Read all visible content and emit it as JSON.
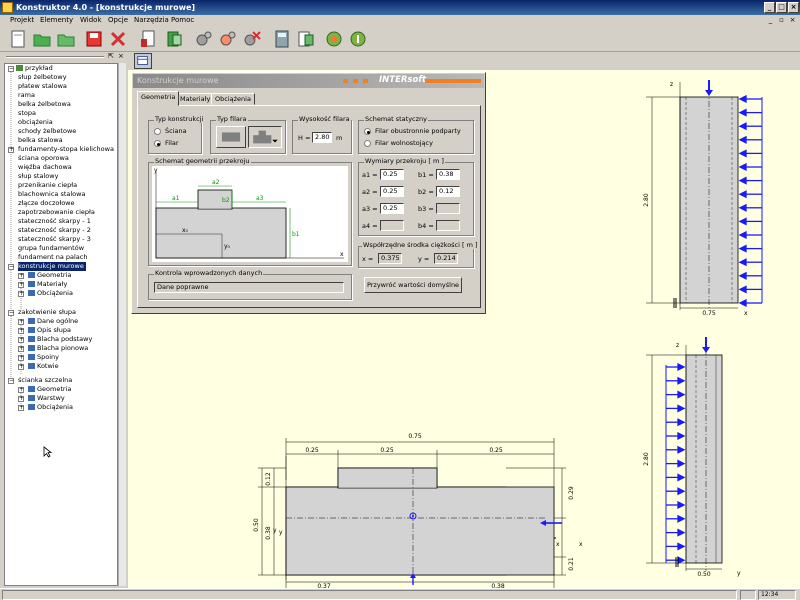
{
  "window": {
    "title": "Konstruktor 4.0 - [konstrukcje murowe]",
    "min": "_",
    "max": "□",
    "close": "×"
  },
  "menu": [
    "Projekt",
    "Elementy",
    "Widok",
    "Opcje",
    "Narzędzia",
    "Pomoc"
  ],
  "tree": {
    "root": "przykład",
    "items": [
      "słup żelbetowy",
      "płatew stalowa",
      "rama",
      "belka żelbetowa",
      "stopa",
      "obciążenia",
      "schody żelbetowe",
      "belka stalowa",
      "fundamenty-stopa kielichowa",
      "ściana oporowa",
      "więźba dachowa",
      "słup stalowy",
      "przenikanie ciepła",
      "blachownica stalowa",
      "złącze doczołowe",
      "zapotrzebowanie ciepła",
      "stateczność skarpy - 1",
      "stateczność skarpy - 2",
      "stateczność skarpy - 3",
      "grupa fundamentów",
      "fundament na palach"
    ],
    "selected": "konstrukcje murowe",
    "selected_children": [
      "Geometria",
      "Materiały",
      "Obciążenia"
    ],
    "group2": "zakotwienie słupa",
    "group2_children": [
      "Dane ogólne",
      "Opis słupa",
      "Blacha podstawy",
      "Blacha pionowa",
      "Spoiny",
      "Kotwie"
    ],
    "group3": "ścianka szczelna",
    "group3_children": [
      "Geometria",
      "Warstwy",
      "Obciążenia"
    ]
  },
  "dialog": {
    "title": "Konstrukcje murowe",
    "brand": "INTERsoft",
    "tabs": [
      "Geometria",
      "Materiały",
      "Obciążenia"
    ],
    "typ_konstrukcji": {
      "label": "Typ konstrukcji",
      "opt1": "Ściana",
      "opt2": "Filar"
    },
    "typ_filara": {
      "label": "Typ filara"
    },
    "wysokosc": {
      "label": "Wysokość filara",
      "h_label": "H =",
      "value": "2.80",
      "unit": "m"
    },
    "schemat_statyczny": {
      "label": "Schemat statyczny",
      "opt1": "Filar obustronnie podparty",
      "opt2": "Filar wolnostojący"
    },
    "schemat_geom": {
      "label": "Schemat geometrii przekroju"
    },
    "wymiary": {
      "label": "Wymiary przekroju [ m ]",
      "a1_label": "a1 =",
      "a1": "0.25",
      "b1_label": "b1 =",
      "b1": "0.38",
      "a2_label": "a2 =",
      "a2": "0.25",
      "b2_label": "b2 =",
      "b2": "0.12",
      "a3_label": "a3 =",
      "a3": "0.25",
      "b3_label": "b3 =",
      "b3": "",
      "a4_label": "a4 =",
      "a4": "",
      "b4_label": "b4 =",
      "b4": ""
    },
    "srodek": {
      "label": "Współrzędne środka ciężkości [ m ]",
      "x_label": "x =",
      "x": "0.375",
      "y_label": "y =",
      "y": "0.214"
    },
    "kontrola": {
      "label": "Kontrola wprowadzonych danych",
      "value": "Dane poprawne"
    },
    "przywroc_button": "Przywróć wartości domyślne"
  },
  "drawings": {
    "section": {
      "top_total": "0.75",
      "top_a": "0.25",
      "top_b": "0.25",
      "top_c": "0.25",
      "left_total": "0.50",
      "left_top": "0.12",
      "left_bottom": "0.38",
      "right_top": "0.29",
      "right_bottom": "0.21",
      "bottom_left": "0.37",
      "bottom_right": "0.38",
      "axis_x": "x",
      "axis_y": "y"
    },
    "elev1": {
      "height": "2.80",
      "width": "0.75",
      "axis_z": "z",
      "axis_x": "x"
    },
    "elev2": {
      "height": "2.80",
      "width": "0.50",
      "axis_z": "z",
      "axis_y": "y"
    }
  },
  "status": {
    "right": "12:34"
  }
}
